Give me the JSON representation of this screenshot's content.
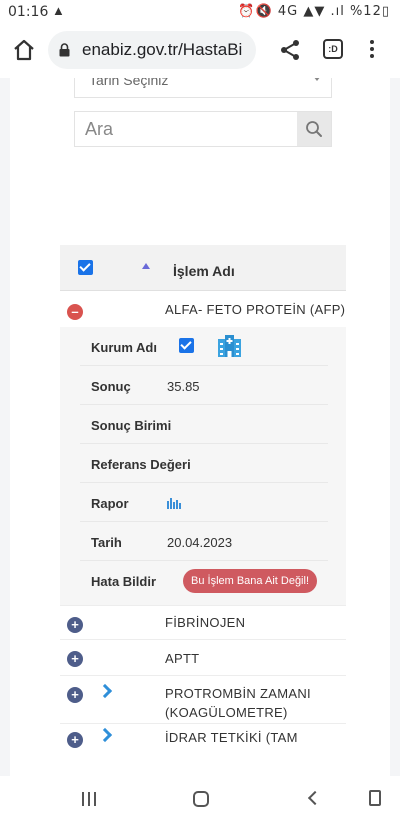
{
  "status_bar": {
    "time": "01:16",
    "warning_icon": "warning-icon",
    "right_text": "⏰🔇 4G ▲▼ .ıl %12▯"
  },
  "browser": {
    "url": "enabiz.gov.tr/HastaBi",
    "tab_icon_text": ":D"
  },
  "filters": {
    "date_placeholder": "Tarih Seçiniz",
    "search_placeholder": "Ara"
  },
  "table": {
    "header": "İşlem Adı",
    "expanded": {
      "name": "ALFA- FETO PROTEİN (AFP)",
      "labels": {
        "kurum": "Kurum Adı",
        "sonuc": "Sonuç",
        "birim": "Sonuç Birimi",
        "referans": "Referans Değeri",
        "rapor": "Rapor",
        "tarih": "Tarih",
        "hata": "Hata Bildir"
      },
      "values": {
        "sonuc": "35.85",
        "birim": "",
        "referans": "",
        "tarih": "20.04.2023"
      },
      "error_button": "Bu İşlem Bana Ait Değil!"
    },
    "rows": [
      {
        "name": "FİBRİNOJEN"
      },
      {
        "name": "APTT"
      },
      {
        "name": "PROTROMBİN ZAMANI (KOAGÜLOMETRE)"
      },
      {
        "name": "İDRAR TETKİKİ (TAM"
      }
    ]
  },
  "colors": {
    "accent_blue": "#1a73e8",
    "minus_red": "#d9534f",
    "plus_navy": "#4e5d8a",
    "error_button": "#cf5a60"
  }
}
